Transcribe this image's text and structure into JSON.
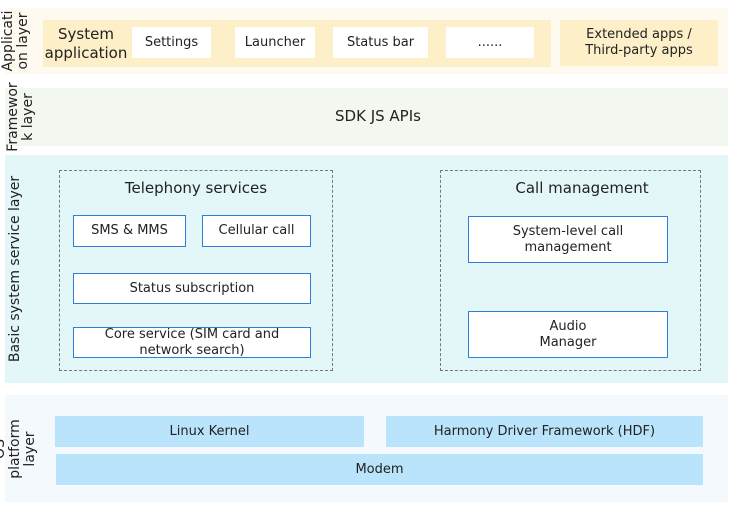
{
  "layers": {
    "application": {
      "label": "Applicati on layer",
      "system_app": "System application",
      "apps": [
        "Settings",
        "Launcher",
        "Status bar",
        "......"
      ],
      "extended": "Extended apps / Third-party apps"
    },
    "framework": {
      "label": "Framewor k layer",
      "sdk": "SDK JS APIs"
    },
    "basic": {
      "label": "Basic system service layer",
      "telephony": {
        "title": "Telephony services",
        "sms": "SMS & MMS",
        "cellular": "Cellular call",
        "status": "Status subscription",
        "core": "Core service (SIM card  and network search)"
      },
      "call": {
        "title": "Call management",
        "system": "System-level call management",
        "audio": "Audio Manager"
      }
    },
    "os": {
      "label": "OS platform layer",
      "linux": "Linux Kernel",
      "hdf": "Harmony Driver Framework (HDF)",
      "modem": "Modem"
    }
  },
  "colors": {
    "app_bg": "#fffaf0",
    "app_bar": "#fdefc8",
    "framework_bg": "#f2f8ef",
    "basic_bg": "#e3f6f8",
    "os_bg": "#f3f9fd",
    "os_box": "#b9e4fb",
    "border": "#2f7fd8"
  }
}
